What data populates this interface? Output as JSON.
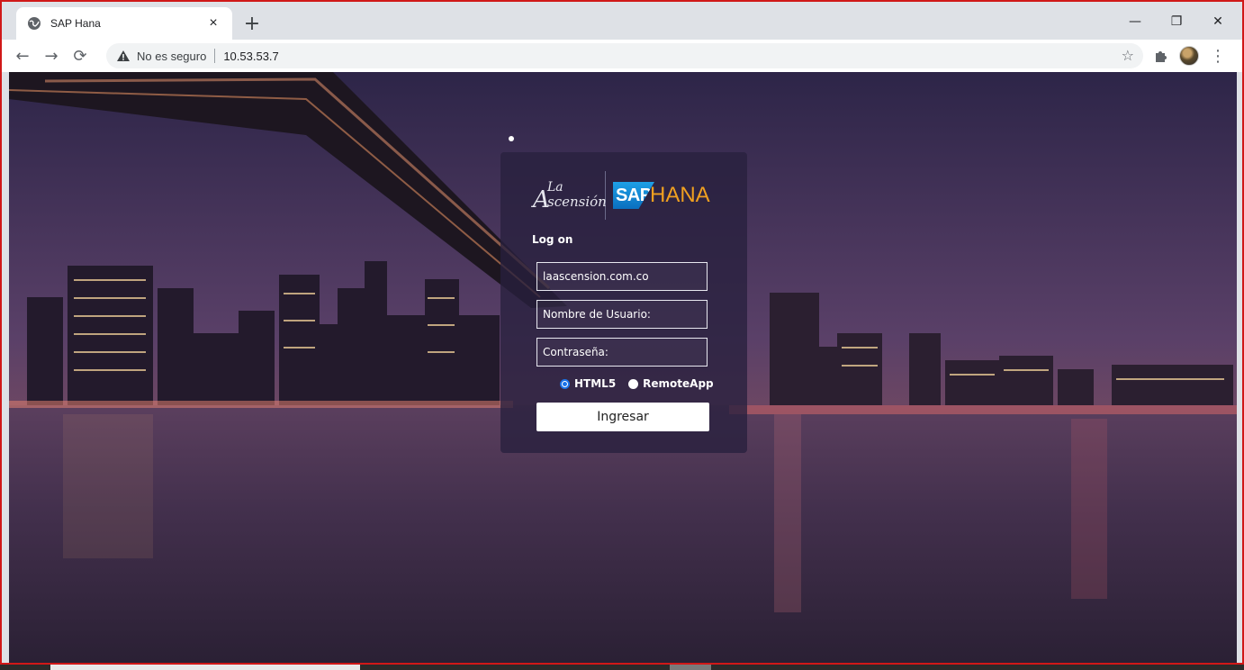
{
  "browser": {
    "tab": {
      "title": "SAP Hana",
      "close_glyph": "×"
    },
    "new_tab_glyph": "+",
    "window_controls": {
      "minimize": "—",
      "restore": "❐",
      "close": "✕"
    },
    "nav": {
      "back": "←",
      "forward": "→",
      "reload": "⟳"
    },
    "omnibox": {
      "security_text": "No es seguro",
      "url": "10.53.53.7"
    },
    "bookmark_glyph": "☆",
    "menu_glyph": "⋮"
  },
  "login": {
    "logo": {
      "left_brand_big": "A",
      "left_brand_small": "La",
      "left_brand_rest": "scensión",
      "sap": "SAP",
      "hana": "HANA"
    },
    "heading": "Log on",
    "domain_value": "laascension.com.co",
    "username_placeholder": "Nombre de Usuario:",
    "password_placeholder": "Contraseña:",
    "options": [
      {
        "label": "HTML5",
        "selected": true
      },
      {
        "label": "RemoteApp",
        "selected": false
      }
    ],
    "submit_label": "Ingresar"
  },
  "colors": {
    "accent_blue": "#1a73e8",
    "sap_blue": "#0a6fbf",
    "hana_orange": "#f0a020",
    "frame_red": "#d01818"
  }
}
